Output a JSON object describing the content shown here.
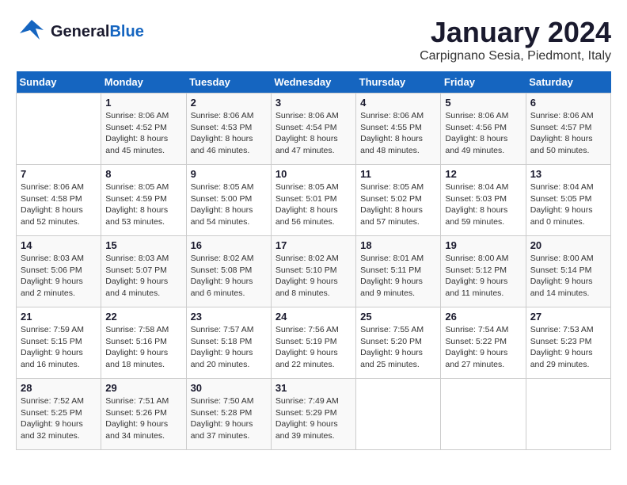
{
  "header": {
    "logo": {
      "general": "General",
      "blue": "Blue"
    },
    "title": "January 2024",
    "subtitle": "Carpignano Sesia, Piedmont, Italy"
  },
  "weekdays": [
    "Sunday",
    "Monday",
    "Tuesday",
    "Wednesday",
    "Thursday",
    "Friday",
    "Saturday"
  ],
  "weeks": [
    [
      {
        "day": "",
        "sunrise": "",
        "sunset": "",
        "daylight": ""
      },
      {
        "day": "1",
        "sunrise": "Sunrise: 8:06 AM",
        "sunset": "Sunset: 4:52 PM",
        "daylight": "Daylight: 8 hours and 45 minutes."
      },
      {
        "day": "2",
        "sunrise": "Sunrise: 8:06 AM",
        "sunset": "Sunset: 4:53 PM",
        "daylight": "Daylight: 8 hours and 46 minutes."
      },
      {
        "day": "3",
        "sunrise": "Sunrise: 8:06 AM",
        "sunset": "Sunset: 4:54 PM",
        "daylight": "Daylight: 8 hours and 47 minutes."
      },
      {
        "day": "4",
        "sunrise": "Sunrise: 8:06 AM",
        "sunset": "Sunset: 4:55 PM",
        "daylight": "Daylight: 8 hours and 48 minutes."
      },
      {
        "day": "5",
        "sunrise": "Sunrise: 8:06 AM",
        "sunset": "Sunset: 4:56 PM",
        "daylight": "Daylight: 8 hours and 49 minutes."
      },
      {
        "day": "6",
        "sunrise": "Sunrise: 8:06 AM",
        "sunset": "Sunset: 4:57 PM",
        "daylight": "Daylight: 8 hours and 50 minutes."
      }
    ],
    [
      {
        "day": "7",
        "sunrise": "Sunrise: 8:06 AM",
        "sunset": "Sunset: 4:58 PM",
        "daylight": "Daylight: 8 hours and 52 minutes."
      },
      {
        "day": "8",
        "sunrise": "Sunrise: 8:05 AM",
        "sunset": "Sunset: 4:59 PM",
        "daylight": "Daylight: 8 hours and 53 minutes."
      },
      {
        "day": "9",
        "sunrise": "Sunrise: 8:05 AM",
        "sunset": "Sunset: 5:00 PM",
        "daylight": "Daylight: 8 hours and 54 minutes."
      },
      {
        "day": "10",
        "sunrise": "Sunrise: 8:05 AM",
        "sunset": "Sunset: 5:01 PM",
        "daylight": "Daylight: 8 hours and 56 minutes."
      },
      {
        "day": "11",
        "sunrise": "Sunrise: 8:05 AM",
        "sunset": "Sunset: 5:02 PM",
        "daylight": "Daylight: 8 hours and 57 minutes."
      },
      {
        "day": "12",
        "sunrise": "Sunrise: 8:04 AM",
        "sunset": "Sunset: 5:03 PM",
        "daylight": "Daylight: 8 hours and 59 minutes."
      },
      {
        "day": "13",
        "sunrise": "Sunrise: 8:04 AM",
        "sunset": "Sunset: 5:05 PM",
        "daylight": "Daylight: 9 hours and 0 minutes."
      }
    ],
    [
      {
        "day": "14",
        "sunrise": "Sunrise: 8:03 AM",
        "sunset": "Sunset: 5:06 PM",
        "daylight": "Daylight: 9 hours and 2 minutes."
      },
      {
        "day": "15",
        "sunrise": "Sunrise: 8:03 AM",
        "sunset": "Sunset: 5:07 PM",
        "daylight": "Daylight: 9 hours and 4 minutes."
      },
      {
        "day": "16",
        "sunrise": "Sunrise: 8:02 AM",
        "sunset": "Sunset: 5:08 PM",
        "daylight": "Daylight: 9 hours and 6 minutes."
      },
      {
        "day": "17",
        "sunrise": "Sunrise: 8:02 AM",
        "sunset": "Sunset: 5:10 PM",
        "daylight": "Daylight: 9 hours and 8 minutes."
      },
      {
        "day": "18",
        "sunrise": "Sunrise: 8:01 AM",
        "sunset": "Sunset: 5:11 PM",
        "daylight": "Daylight: 9 hours and 9 minutes."
      },
      {
        "day": "19",
        "sunrise": "Sunrise: 8:00 AM",
        "sunset": "Sunset: 5:12 PM",
        "daylight": "Daylight: 9 hours and 11 minutes."
      },
      {
        "day": "20",
        "sunrise": "Sunrise: 8:00 AM",
        "sunset": "Sunset: 5:14 PM",
        "daylight": "Daylight: 9 hours and 14 minutes."
      }
    ],
    [
      {
        "day": "21",
        "sunrise": "Sunrise: 7:59 AM",
        "sunset": "Sunset: 5:15 PM",
        "daylight": "Daylight: 9 hours and 16 minutes."
      },
      {
        "day": "22",
        "sunrise": "Sunrise: 7:58 AM",
        "sunset": "Sunset: 5:16 PM",
        "daylight": "Daylight: 9 hours and 18 minutes."
      },
      {
        "day": "23",
        "sunrise": "Sunrise: 7:57 AM",
        "sunset": "Sunset: 5:18 PM",
        "daylight": "Daylight: 9 hours and 20 minutes."
      },
      {
        "day": "24",
        "sunrise": "Sunrise: 7:56 AM",
        "sunset": "Sunset: 5:19 PM",
        "daylight": "Daylight: 9 hours and 22 minutes."
      },
      {
        "day": "25",
        "sunrise": "Sunrise: 7:55 AM",
        "sunset": "Sunset: 5:20 PM",
        "daylight": "Daylight: 9 hours and 25 minutes."
      },
      {
        "day": "26",
        "sunrise": "Sunrise: 7:54 AM",
        "sunset": "Sunset: 5:22 PM",
        "daylight": "Daylight: 9 hours and 27 minutes."
      },
      {
        "day": "27",
        "sunrise": "Sunrise: 7:53 AM",
        "sunset": "Sunset: 5:23 PM",
        "daylight": "Daylight: 9 hours and 29 minutes."
      }
    ],
    [
      {
        "day": "28",
        "sunrise": "Sunrise: 7:52 AM",
        "sunset": "Sunset: 5:25 PM",
        "daylight": "Daylight: 9 hours and 32 minutes."
      },
      {
        "day": "29",
        "sunrise": "Sunrise: 7:51 AM",
        "sunset": "Sunset: 5:26 PM",
        "daylight": "Daylight: 9 hours and 34 minutes."
      },
      {
        "day": "30",
        "sunrise": "Sunrise: 7:50 AM",
        "sunset": "Sunset: 5:28 PM",
        "daylight": "Daylight: 9 hours and 37 minutes."
      },
      {
        "day": "31",
        "sunrise": "Sunrise: 7:49 AM",
        "sunset": "Sunset: 5:29 PM",
        "daylight": "Daylight: 9 hours and 39 minutes."
      },
      {
        "day": "",
        "sunrise": "",
        "sunset": "",
        "daylight": ""
      },
      {
        "day": "",
        "sunrise": "",
        "sunset": "",
        "daylight": ""
      },
      {
        "day": "",
        "sunrise": "",
        "sunset": "",
        "daylight": ""
      }
    ]
  ]
}
